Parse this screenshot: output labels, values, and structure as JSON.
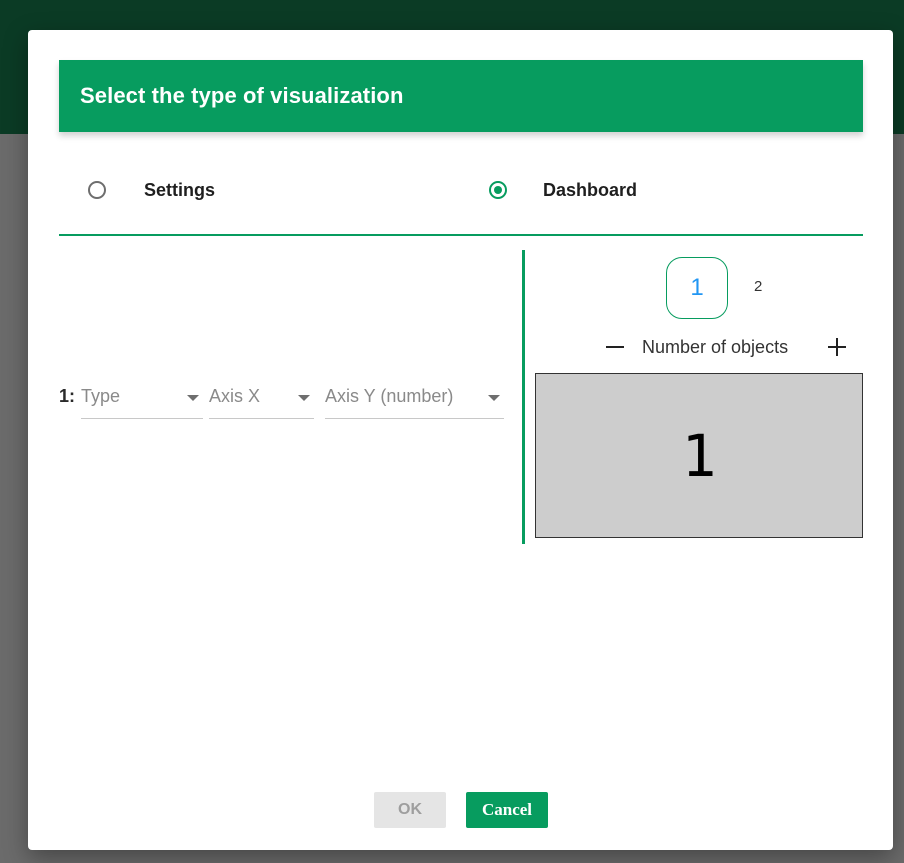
{
  "dialog": {
    "title": "Select the type of visualization"
  },
  "view_options": [
    {
      "label": "Settings",
      "selected": false
    },
    {
      "label": "Dashboard",
      "selected": true
    }
  ],
  "config_row": {
    "index": "1:",
    "type_placeholder": "Type",
    "axis_x_placeholder": "Axis X",
    "axis_y_placeholder": "Axis Y (number)"
  },
  "pagination": {
    "pages": [
      "1",
      "2"
    ],
    "current": "1"
  },
  "objects": {
    "label": "Number of objects",
    "preview_number": "1"
  },
  "footer": {
    "ok_label": "OK",
    "cancel_label": "Cancel",
    "ok_disabled": true
  },
  "colors": {
    "accent": "#079c5f",
    "header_background": "#0b3b25",
    "active_page_text": "#2196f3",
    "preview_fill": "#cdcdcd"
  }
}
